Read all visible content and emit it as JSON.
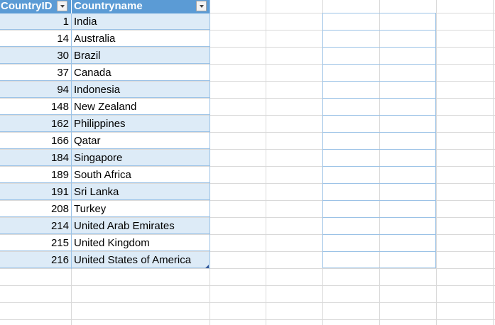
{
  "table": {
    "headers": {
      "country_id": "CountryID",
      "country_name": "Countryname"
    },
    "rows": [
      {
        "id": "1",
        "name": "India"
      },
      {
        "id": "14",
        "name": "Australia"
      },
      {
        "id": "30",
        "name": "Brazil"
      },
      {
        "id": "37",
        "name": "Canada"
      },
      {
        "id": "94",
        "name": "Indonesia"
      },
      {
        "id": "148",
        "name": "New Zealand"
      },
      {
        "id": "162",
        "name": "Philippines"
      },
      {
        "id": "166",
        "name": "Qatar"
      },
      {
        "id": "184",
        "name": "Singapore"
      },
      {
        "id": "189",
        "name": "South Africa"
      },
      {
        "id": "191",
        "name": "Sri Lanka"
      },
      {
        "id": "208",
        "name": "Turkey"
      },
      {
        "id": "214",
        "name": "United Arab Emirates"
      },
      {
        "id": "215",
        "name": "United Kingdom"
      },
      {
        "id": "216",
        "name": "United States of America"
      }
    ]
  },
  "icons": {
    "filter": "filter-dropdown-icon",
    "resize": "table-resize-handle-icon"
  },
  "colors": {
    "header_bg": "#5b9bd5",
    "band_bg": "#ddebf7",
    "border": "#9bc2e6",
    "gridline": "#d9d9d9"
  }
}
